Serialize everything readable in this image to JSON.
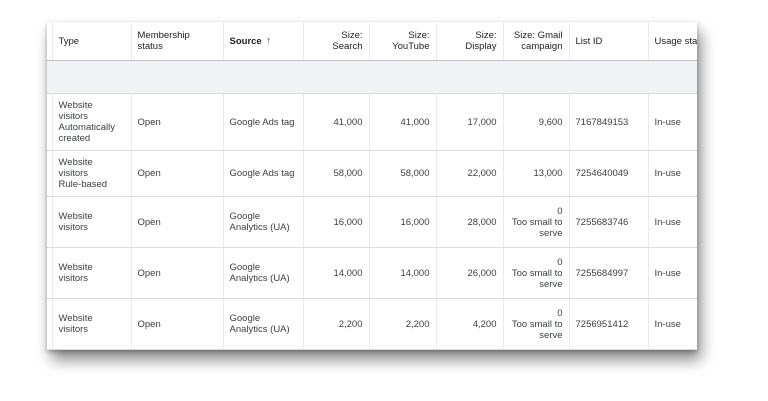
{
  "columns": {
    "type": "Type",
    "membership_status": "Membership status",
    "source": "Source",
    "size_search": "Size: Search",
    "size_youtube": "Size: YouTube",
    "size_display": "Size: Display",
    "size_gmail": "Size: Gmail campaign",
    "list_id": "List ID",
    "usage_status": "Usage status"
  },
  "sort_arrow": "↑",
  "rows": [
    {
      "type_line1": "Website visitors",
      "type_line2": "Automatically created",
      "membership": "Open",
      "source": "Google Ads tag",
      "search": "41,000",
      "youtube": "41,000",
      "display": "17,000",
      "gmail": "9,600",
      "gmail_note": "",
      "list_id": "7167849153",
      "usage": "In-use"
    },
    {
      "type_line1": "Website visitors",
      "type_line2": "Rule-based",
      "membership": "Open",
      "source": "Google Ads tag",
      "search": "58,000",
      "youtube": "58,000",
      "display": "22,000",
      "gmail": "13,000",
      "gmail_note": "",
      "list_id": "7254640049",
      "usage": "In-use"
    },
    {
      "type_line1": "Website visitors",
      "type_line2": "",
      "membership": "Open",
      "source": "Google Analytics (UA)",
      "search": "16,000",
      "youtube": "16,000",
      "display": "28,000",
      "gmail": "0",
      "gmail_note": "Too small to serve",
      "list_id": "7255683746",
      "usage": "In-use"
    },
    {
      "type_line1": "Website visitors",
      "type_line2": "",
      "membership": "Open",
      "source": "Google Analytics (UA)",
      "search": "14,000",
      "youtube": "14,000",
      "display": "26,000",
      "gmail": "0",
      "gmail_note": "Too small to serve",
      "list_id": "7255684997",
      "usage": "In-use"
    },
    {
      "type_line1": "Website visitors",
      "type_line2": "",
      "membership": "Open",
      "source": "Google Analytics (UA)",
      "search": "2,200",
      "youtube": "2,200",
      "display": "4,200",
      "gmail": "0",
      "gmail_note": "Too small to serve",
      "list_id": "7256951412",
      "usage": "In-use"
    }
  ]
}
